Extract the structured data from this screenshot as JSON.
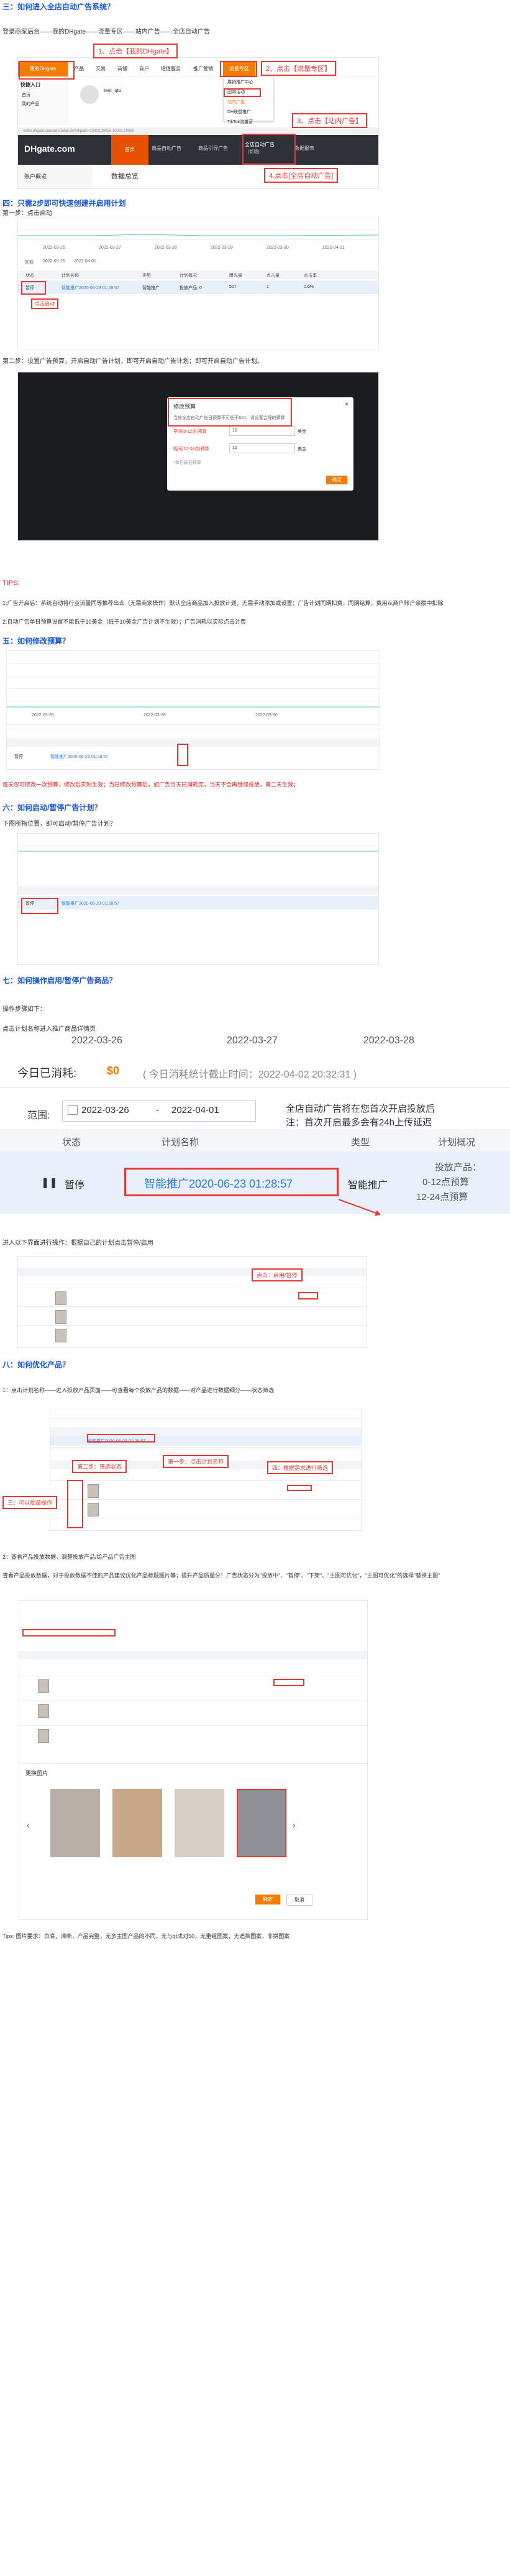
{
  "sections": {
    "s3_title": "三：如何进入全店自动广告系统？",
    "s3_path": "登录商家后台——我的DHgate——流量专区——站内广告——全店自动广告",
    "s4_title": "四：只需2步即可快速创建并启用计划",
    "s4_step1": "第一步：点击启动",
    "s4_step2": "第二步：设置广告预算，开启自动广告计划，即可开启自动广告计划；即可开启自动广告计划。",
    "tips_title": "TIPS:",
    "tips_1": "1:广告开启后：系统自动将行业流量同等推荐出去（无需商家操作）默认全店商品加入投放计划，无需手动添加或设置；广告计划同期扣费，同期结算，费用从商户账户余额中扣除",
    "tips_2": "2:自动广告单日预算设置不能低于10美金（低于10美金广告计划不生效）；广告消耗以实际点击计费",
    "s5_title": "五：如何修改预算？",
    "s5_note": "每天仅可修改一次预算，修改后实时生效；当日修改预算后，如广告当天已消耗完，当天不会再继续投放，第二天生效；",
    "s6_title": "六：如何启动/暂停广告计划？",
    "s6_text": "下图所指位置，即可启动/暂停广告计划？",
    "s7_title": "七：如何操作启用/暂停广告商品？",
    "s7_sub": "操作步骤如下：",
    "s7_step1": "点击计划名称进入推广商品详情页",
    "s7_step2": "进入以下界面进行操作：根据自己的计划点击暂停/启用",
    "s8_title": "八：如何优化产品？",
    "s8_step1": "1：点击计划名称——进入投放产品页面——可查看每个投放产品的数据——对产品进行数据细分——状态筛选",
    "s8_step2": "2：查看产品投放数据，调整投放产品/给产品广告主图",
    "s8_text": "查看产品投放数据，对于投放数据不佳的产品建议优化产品标题图片等；提升产品质量分！广告状态分为\"投放中\"、\"暂停\"、\"下架\"、\"主图可优化\"，\"主图可优化\"的选择\"替换主图\"",
    "footer": "Tips: 图片要求：白底，清晰，产品完整，无多主图产品的不同，无与gt成对50，无重组图案，无遮挡图案，非拼图案"
  },
  "dhgate_nav": {
    "logo": "我的DHgate",
    "items": [
      "产品",
      "交易",
      "商铺",
      "商户",
      "增值服务",
      "推广营销",
      "流量专区",
      "买家"
    ],
    "dropdown": [
      "展销推广中心",
      "团购活动",
      "站内广告",
      "DH联盟推广",
      "TikTok流量营"
    ],
    "sidebar_title": "快捷入口",
    "sidebar_items": [
      "首页",
      "我的产品"
    ],
    "user_name": "test_qtu",
    "url": "seller.dhgate.com/adsDetail.do?dhpath=10003,10026,10032,10060",
    "logo2": "DHgate.com",
    "tabs": [
      "首页",
      "商品自动广告",
      "商品引导广告",
      "全店自动广告",
      "数据报表"
    ],
    "tab_sub": "(新版)",
    "left_menu": "账户概览",
    "data_title": "数据总览"
  },
  "callouts": {
    "c1": "1、点击【我的DHgate】",
    "c2": "2、点击【流量专区】",
    "c3": "3、点击【站内广告】",
    "c4": "4.点击[全店自动广告]",
    "c_start": "点击启动",
    "c_pause": "点击：启用/暂停",
    "c_step2_filter": "第二步：筛选状态",
    "c_step1_click": "第一步：点击计划名称",
    "c_step3_batch": "四：根据需求进行筛选",
    "c_step3_mouse": "三：可以批量操作",
    "c_replace": "替换主图"
  },
  "chart": {
    "dates": [
      "2022-03-26",
      "2022-03-27",
      "2022-03-28"
    ],
    "small_dates": [
      "2022-03-26",
      "2022-03-27",
      "2022-03-28",
      "2022-03-29",
      "2022-03-30",
      "2022-04-01"
    ]
  },
  "plan_table": {
    "spent_label": "今日已消耗:",
    "spent_value": "$0",
    "spent_note": "( 今日消耗统计截止时间：2022-04-02 20:32:31 )",
    "range_label": "范围:",
    "range_from": "2022-03-26",
    "range_sep": "-",
    "range_to": "2022-04-01",
    "notice_1": "全店自动广告将在您首次开启投放后",
    "notice_2": "注：首次开启最多会有24h上传延迟",
    "headers": [
      "状态",
      "计划名称",
      "类型",
      "计划概况"
    ],
    "row_status": "暂停",
    "row_name": "智能推广2020-06-23 01:28:57",
    "row_type": "智能推广",
    "row_summary_1": "投放产品：",
    "row_summary_2": "0-12点预算",
    "row_summary_3": "12-24点预算",
    "small_headers": [
      "状态",
      "计划名称",
      "类型",
      "计划概况",
      "曝光量",
      "点击量",
      "点击率",
      "花费",
      "操作"
    ],
    "small_row": [
      "暂停",
      "智能推广2020-06-23 01:28:57",
      "智能推广",
      "投放产品: 0",
      "557",
      "1",
      "0.6%"
    ]
  },
  "budget_dialog": {
    "title": "修改预算",
    "desc": "当前全店自动广告日预算不可低于$10，请设置合理的预算",
    "label1": "早间(0-12点)预算",
    "label2": "晚间(12-24点)预算",
    "value1": "10",
    "value2": "10",
    "unit": "美金",
    "hint": "*单日最低预算",
    "close": "×",
    "ok": "确定"
  },
  "image_dialog": {
    "title": "更换图片",
    "ok": "确定",
    "cancel": "取消"
  },
  "colors": {
    "accent": "#f57c00",
    "red": "#e53935",
    "heading": "#1a56d6",
    "link": "#2d7be0",
    "dark_bg": "#3d3f45"
  }
}
